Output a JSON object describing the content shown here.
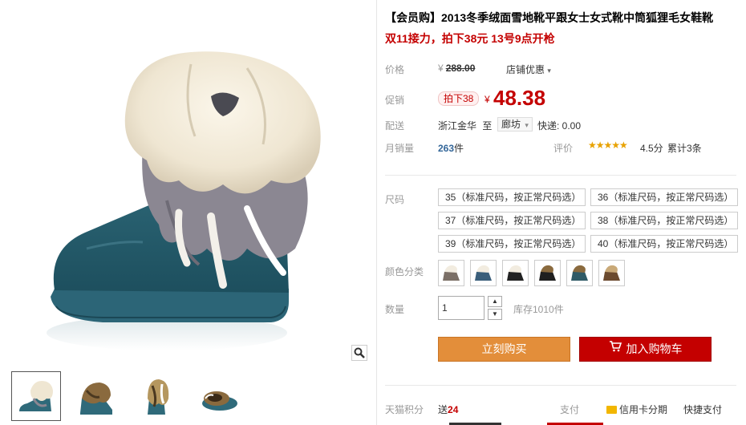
{
  "product": {
    "title": "【会员购】2013冬季绒面雪地靴平跟女士女式靴中筒狐狸毛女鞋靴",
    "subtitle": "双11接力，拍下38元 13号9点开枪"
  },
  "price": {
    "label": "价格",
    "currency": "¥",
    "original": "288.00",
    "store_promo": "店铺优惠",
    "store_promo_icon": "chevron-down-icon"
  },
  "promo": {
    "label": "促销",
    "tag": "拍下38",
    "currency": "¥",
    "price": "48.38"
  },
  "shipping": {
    "label": "配送",
    "from": "浙江金华",
    "to_word": "至",
    "to": "廊坊",
    "fee": "快递: 0.00"
  },
  "sales": {
    "label": "月销量",
    "count": "263",
    "unit": "件",
    "rating_label": "评价",
    "stars": "★★★★★",
    "score": "4.5分",
    "total": "累计3条"
  },
  "size": {
    "label": "尺码",
    "options": [
      "35（标准尺码，按正常尺码选）",
      "36（标准尺码，按正常尺码选）",
      "37（标准尺码，按正常尺码选）",
      "38（标准尺码，按正常尺码选）",
      "39（标准尺码，按正常尺码选）",
      "40（标准尺码，按正常尺码选）"
    ]
  },
  "color": {
    "label": "颜色分类"
  },
  "quantity": {
    "label": "数量",
    "value": "1",
    "stock": "库存1010件"
  },
  "actions": {
    "buy_now": "立刻购买",
    "add_cart": "加入购物车"
  },
  "footer": {
    "points_label": "天猫积分",
    "points_text": "送",
    "points_value": "24",
    "pay_label": "支付",
    "credit": "信用卡分期",
    "quick": "快捷支付"
  },
  "colors": {
    "accent_red": "#c40000",
    "buy_orange": "#e38e3a",
    "link_blue": "#336699",
    "star_gold": "#e8a200"
  }
}
